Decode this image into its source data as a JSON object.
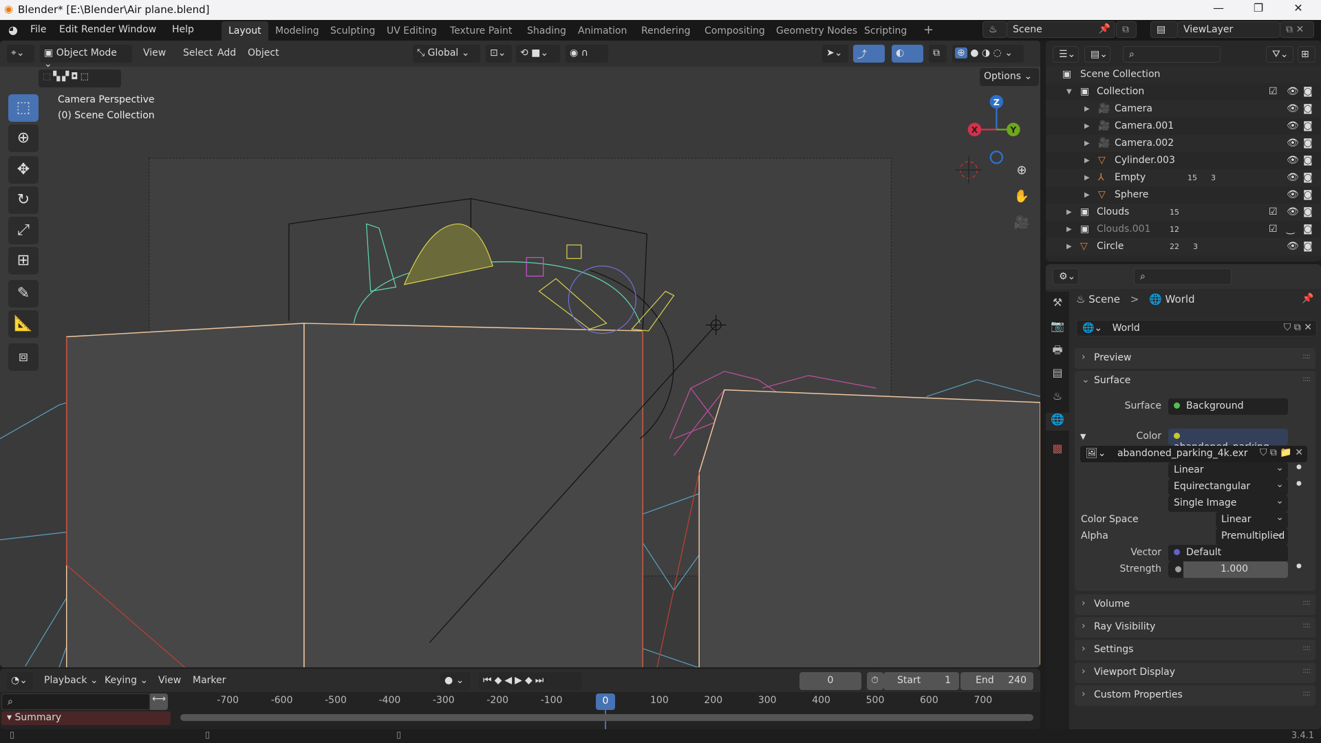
{
  "window": {
    "title": "Blender* [E:\\Blender\\Air plane.blend]",
    "minimize": "—",
    "maximize": "❐",
    "close": "✕"
  },
  "menubar": {
    "items": [
      "File",
      "Edit",
      "Render",
      "Window",
      "Help"
    ]
  },
  "workspaces": {
    "tabs": [
      "Layout",
      "Modeling",
      "Sculpting",
      "UV Editing",
      "Texture Paint",
      "Shading",
      "Animation",
      "Rendering",
      "Compositing",
      "Geometry Nodes",
      "Scripting"
    ],
    "active": "Layout",
    "add": "+"
  },
  "scene": {
    "name": "Scene",
    "view_layer": "ViewLayer"
  },
  "viewport": {
    "mode": "Object Mode",
    "menus": [
      "View",
      "Select",
      "Add",
      "Object"
    ],
    "transform_orientation": "Global",
    "options": "Options",
    "overlay_title": "Camera Perspective",
    "overlay_subtitle": "(0) Scene Collection",
    "gizmo": {
      "x": "X",
      "y": "Y",
      "z": "Z"
    },
    "colors": {
      "x": "#d8304a",
      "y": "#6ea81a",
      "z": "#2e70c8",
      "wire_terrain": "#5aa0c0",
      "wire_selected": "#f0c8a0",
      "wire_clouds": "#c050a0"
    }
  },
  "outliner": {
    "root": "Scene Collection",
    "rows": [
      {
        "name": "Collection",
        "type": "collection",
        "level": 1,
        "expanded": true,
        "checkbox": true
      },
      {
        "name": "Camera",
        "type": "camera",
        "level": 2
      },
      {
        "name": "Camera.001",
        "type": "camera",
        "level": 2
      },
      {
        "name": "Camera.002",
        "type": "camera",
        "level": 2
      },
      {
        "name": "Cylinder.003",
        "type": "mesh",
        "level": 2
      },
      {
        "name": "Empty",
        "type": "empty",
        "level": 2,
        "badges": [
          "15",
          "3"
        ]
      },
      {
        "name": "Sphere",
        "type": "mesh",
        "level": 2
      },
      {
        "name": "Clouds",
        "type": "collection",
        "level": 1,
        "checkbox": true,
        "badges": [
          "15"
        ]
      },
      {
        "name": "Clouds.001",
        "type": "collection",
        "level": 1,
        "checkbox": true,
        "dimmed": true,
        "badges": [
          "12"
        ]
      },
      {
        "name": "Circle",
        "type": "mesh",
        "level": 1,
        "badges": [
          "22",
          "3"
        ]
      }
    ]
  },
  "properties": {
    "breadcrumb": [
      "Scene",
      "World"
    ],
    "world_name": "World",
    "panels": {
      "preview": "Preview",
      "surface": "Surface",
      "volume": "Volume",
      "ray_visibility": "Ray Visibility",
      "settings": "Settings",
      "viewport_display": "Viewport Display",
      "custom_properties": "Custom Properties"
    },
    "surface": {
      "surface_label": "Surface",
      "surface_value": "Background",
      "color_label": "Color",
      "color_value": "abandoned_parking_...",
      "image_name": "abandoned_parking_4k.exr",
      "interpolation": "Linear",
      "projection": "Equirectangular",
      "source": "Single Image",
      "color_space_label": "Color Space",
      "color_space": "Linear",
      "alpha_label": "Alpha",
      "alpha": "Premultiplied",
      "vector_label": "Vector",
      "vector": "Default",
      "strength_label": "Strength",
      "strength": "1.000"
    },
    "socket_colors": {
      "surface": "#4fc04f",
      "color": "#c8c82a",
      "vector": "#6363c7",
      "strength": "#a0a0a0"
    }
  },
  "timeline": {
    "menus": [
      "Playback",
      "Keying",
      "View",
      "Marker"
    ],
    "current_frame": "0",
    "start_label": "Start",
    "start": "1",
    "end_label": "End",
    "end": "240",
    "ruler": [
      "-700",
      "-600",
      "-500",
      "-400",
      "-300",
      "-200",
      "-100",
      "0",
      "100",
      "200",
      "300",
      "400",
      "500",
      "600",
      "700"
    ],
    "summary": "Summary"
  },
  "status": {
    "version": "3.4.1"
  }
}
